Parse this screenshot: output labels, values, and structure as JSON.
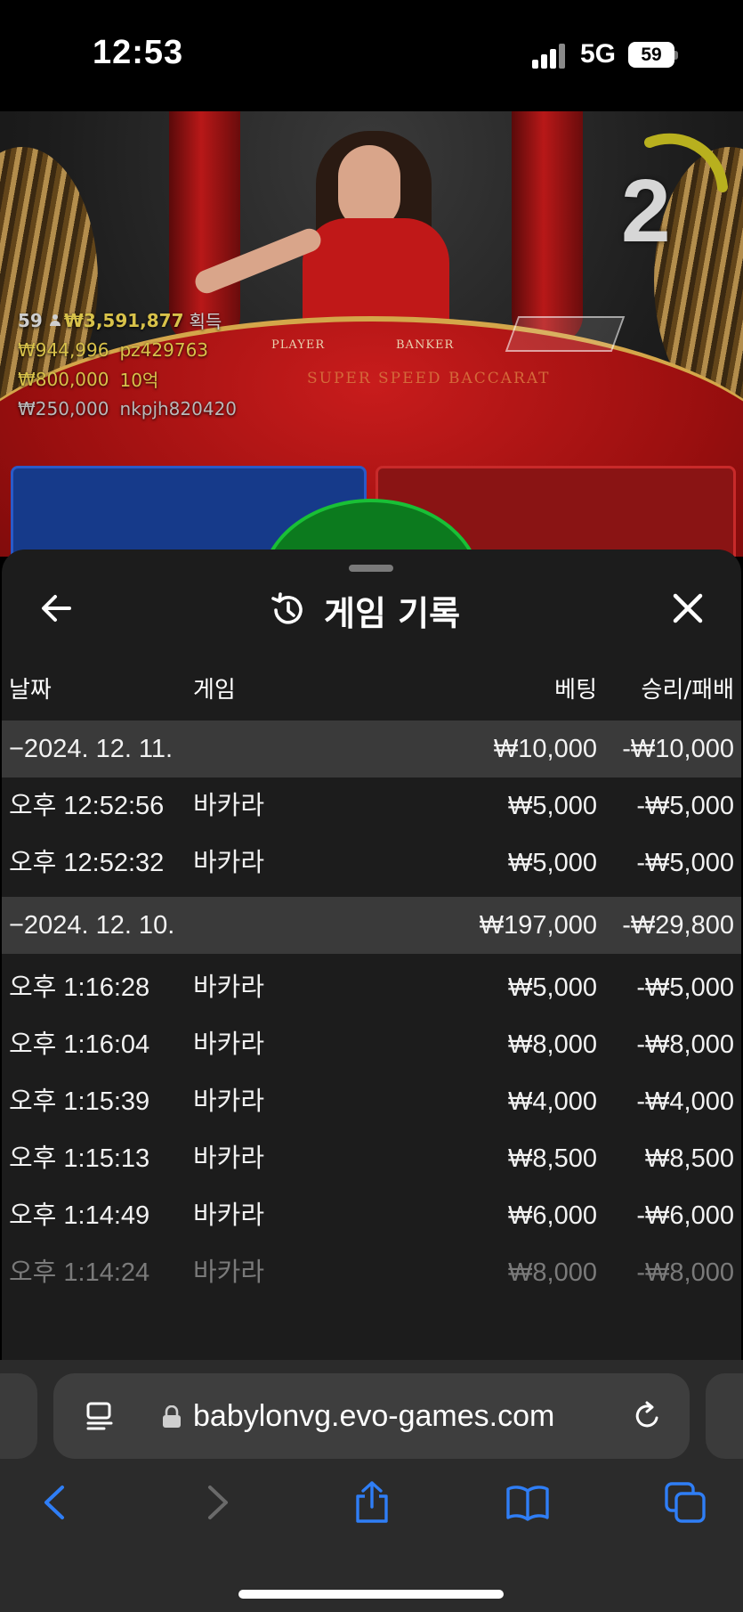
{
  "status_bar": {
    "time": "12:53",
    "network": "5G",
    "battery": "59"
  },
  "video": {
    "countdown": "2",
    "table_labels": {
      "player": "PLAYER",
      "banker": "BANKER",
      "logo": "SUPER SPEED BACCARAT"
    },
    "winners": {
      "total_count": "59",
      "total_amount": "₩3,591,877",
      "gain_label": "획득",
      "entries": [
        {
          "amount": "₩944,996",
          "name": "pz429763"
        },
        {
          "amount": "₩800,000",
          "name": "10억"
        },
        {
          "amount": "₩250,000",
          "name": "nkpjh820420"
        }
      ]
    }
  },
  "history": {
    "title": "게임 기록",
    "columns": {
      "date": "날짜",
      "game": "게임",
      "bet": "베팅",
      "result": "승리/패배"
    },
    "groups": [
      {
        "date": "−2024. 12. 11.",
        "bet": "₩10,000",
        "result": "-₩10,000",
        "items": [
          {
            "time": "오후 12:52:56",
            "game": "바카라",
            "bet": "₩5,000",
            "result": "-₩5,000"
          },
          {
            "time": "오후 12:52:32",
            "game": "바카라",
            "bet": "₩5,000",
            "result": "-₩5,000"
          }
        ]
      },
      {
        "date": "−2024. 12. 10.",
        "bet": "₩197,000",
        "result": "-₩29,800",
        "items": [
          {
            "time": "오후 1:16:28",
            "game": "바카라",
            "bet": "₩5,000",
            "result": "-₩5,000"
          },
          {
            "time": "오후 1:16:04",
            "game": "바카라",
            "bet": "₩8,000",
            "result": "-₩8,000"
          },
          {
            "time": "오후 1:15:39",
            "game": "바카라",
            "bet": "₩4,000",
            "result": "-₩4,000"
          },
          {
            "time": "오후 1:15:13",
            "game": "바카라",
            "bet": "₩8,500",
            "result": "₩8,500"
          },
          {
            "time": "오후 1:14:49",
            "game": "바카라",
            "bet": "₩6,000",
            "result": "-₩6,000"
          },
          {
            "time": "오후 1:14:24",
            "game": "바카라",
            "bet": "₩8,000",
            "result": "-₩8,000"
          }
        ]
      }
    ]
  },
  "browser": {
    "url": "babylonvg.evo-games.com",
    "accent": "#2f7ef6"
  },
  "colors": {
    "gold": "#d8c24a",
    "sheet_bg": "#1c1c1c",
    "group_row_bg": "#3a3a3a"
  }
}
